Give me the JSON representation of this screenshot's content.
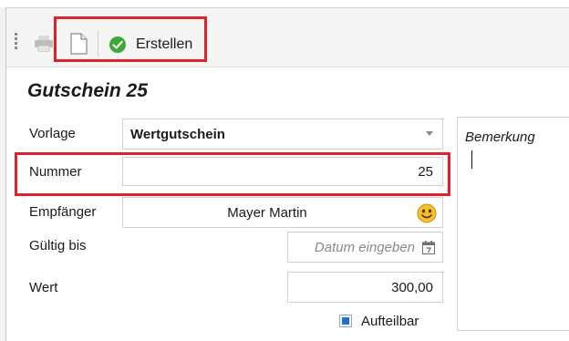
{
  "toolbar": {
    "erstellen_label": "Erstellen",
    "icons": [
      "grip-icon",
      "printer-icon",
      "document-icon",
      "check-circle-icon"
    ]
  },
  "form": {
    "title": "Gutschein 25",
    "vorlage": {
      "label": "Vorlage",
      "value": "Wertgutschein"
    },
    "nummer": {
      "label": "Nummer",
      "value": "25"
    },
    "empfaenger": {
      "label": "Empfänger",
      "value": "Mayer Martin"
    },
    "gueltig_bis": {
      "label": "Gültig bis",
      "placeholder": "Datum eingeben"
    },
    "wert": {
      "label": "Wert",
      "value": "300,00"
    },
    "aufteilbar": {
      "label": "Aufteilbar",
      "checked": true
    }
  },
  "remarks": {
    "label": "Bemerkung",
    "value": ""
  },
  "colors": {
    "highlight": "#e0202a",
    "check_green": "#3aa935",
    "checkbox_fill": "#1f6fd1"
  }
}
